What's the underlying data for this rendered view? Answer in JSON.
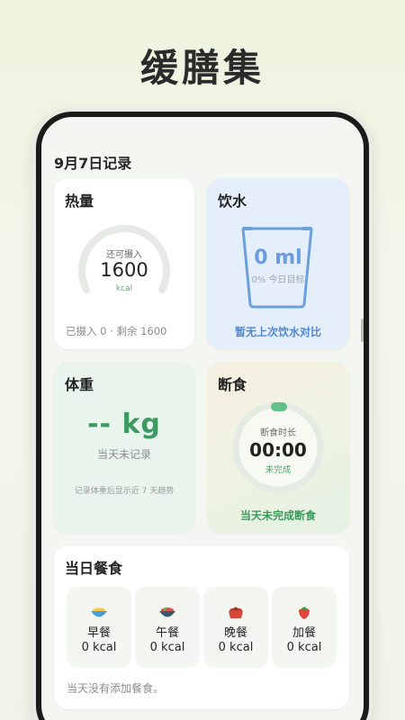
{
  "app": {
    "title": "缓膳集"
  },
  "date_header": "9月7日记录",
  "calorie": {
    "title": "热量",
    "gauge_subtitle": "还可摄入",
    "remaining_value": "1600",
    "unit": "kcal",
    "summary": "已摄入 0 · 剩余 1600",
    "progress_fraction": 0
  },
  "water": {
    "title": "饮水",
    "value": "0 ml",
    "percent_label": "0% 今日目标",
    "compare_text": "暂无上次饮水对比",
    "progress_fraction": 0
  },
  "weight": {
    "title": "体重",
    "value": "-- kg",
    "status": "当天未记录",
    "hint": "记录体重后显示近 7 天趋势"
  },
  "fasting": {
    "title": "断食",
    "label": "断食时长",
    "time": "00:00",
    "state": "未完成",
    "status": "当天未完成断食"
  },
  "meals": {
    "title": "当日餐食",
    "items": [
      {
        "name": "早餐",
        "kcal": "0 kcal",
        "icon": "breakfast-bowl-icon"
      },
      {
        "name": "午餐",
        "kcal": "0 kcal",
        "icon": "lunch-bowl-icon"
      },
      {
        "name": "晚餐",
        "kcal": "0 kcal",
        "icon": "dinner-pot-icon"
      },
      {
        "name": "加餐",
        "kcal": "0 kcal",
        "icon": "snack-strawberry-icon"
      }
    ],
    "empty_text": "当天没有添加餐食。"
  },
  "colors": {
    "accent_green": "#3e9a62",
    "water_blue": "#4d88d6",
    "gauge_track": "#e6e9e6"
  }
}
